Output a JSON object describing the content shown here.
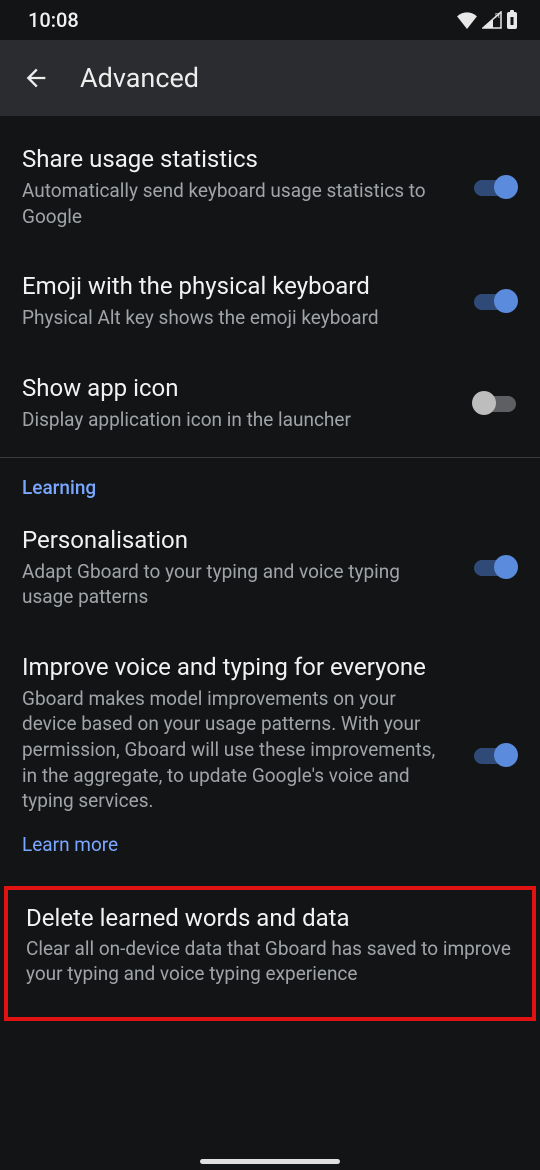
{
  "status": {
    "time": "10:08"
  },
  "header": {
    "title": "Advanced"
  },
  "settings": {
    "share_usage": {
      "title": "Share usage statistics",
      "sub": "Automatically send keyboard usage statistics to Google",
      "on": true
    },
    "emoji_physical": {
      "title": "Emoji with the physical keyboard",
      "sub": "Physical Alt key shows the emoji keyboard",
      "on": true
    },
    "show_app_icon": {
      "title": "Show app icon",
      "sub": "Display application icon in the launcher",
      "on": false
    }
  },
  "section_learning": {
    "header": "Learning"
  },
  "learning": {
    "personalisation": {
      "title": "Personalisation",
      "sub": "Adapt Gboard to your typing and voice typing usage patterns",
      "on": true
    },
    "improve": {
      "title": "Improve voice and typing for everyone",
      "sub": "Gboard makes model improvements on your device based on your usage patterns. With your permission, Gboard will use these improvements, in the aggregate, to update Google's voice and typing services.",
      "learn_more": "Learn more",
      "on": true
    },
    "delete": {
      "title": "Delete learned words and data",
      "sub": "Clear all on-device data that Gboard has saved to improve your typing and voice typing experience"
    }
  }
}
